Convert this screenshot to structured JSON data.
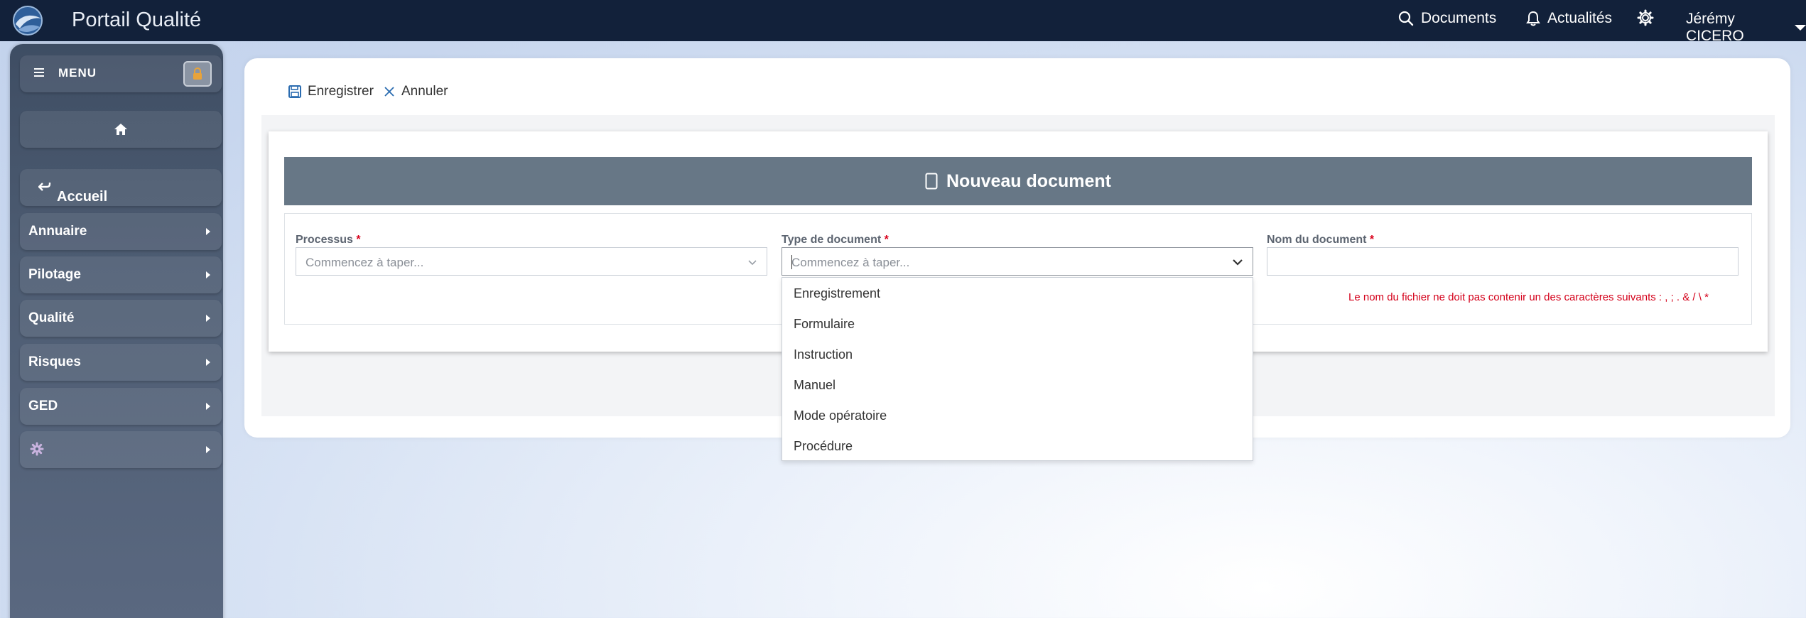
{
  "app": {
    "title": "Portail Qualité"
  },
  "topbar": {
    "documents_label": "Documents",
    "news_label": "Actualités",
    "user_name": "Jérémy CICERO"
  },
  "sidebar": {
    "menu_label": "MENU",
    "accueil_label": "Accueil",
    "items": [
      {
        "label": "Annuaire"
      },
      {
        "label": "Pilotage"
      },
      {
        "label": "Qualité"
      },
      {
        "label": "Risques"
      },
      {
        "label": "GED"
      }
    ]
  },
  "toolbar": {
    "save_label": "Enregistrer",
    "cancel_label": "Annuler"
  },
  "form": {
    "title": "Nouveau document",
    "required_marker": "*",
    "processus": {
      "label": "Processus",
      "placeholder": "Commencez à taper..."
    },
    "type_document": {
      "label": "Type de document",
      "placeholder": "Commencez à taper...",
      "options": [
        "Enregistrement",
        "Formulaire",
        "Instruction",
        "Manuel",
        "Mode opératoire",
        "Procédure"
      ]
    },
    "nom_document": {
      "label": "Nom du document",
      "value": ""
    },
    "warning": "Le nom du fichier ne doit pas contenir un des caractères suivants : , ; . & / \\ *"
  },
  "colors": {
    "topbar": "#12213a",
    "form_header": "#677786",
    "required": "#d9001b"
  }
}
